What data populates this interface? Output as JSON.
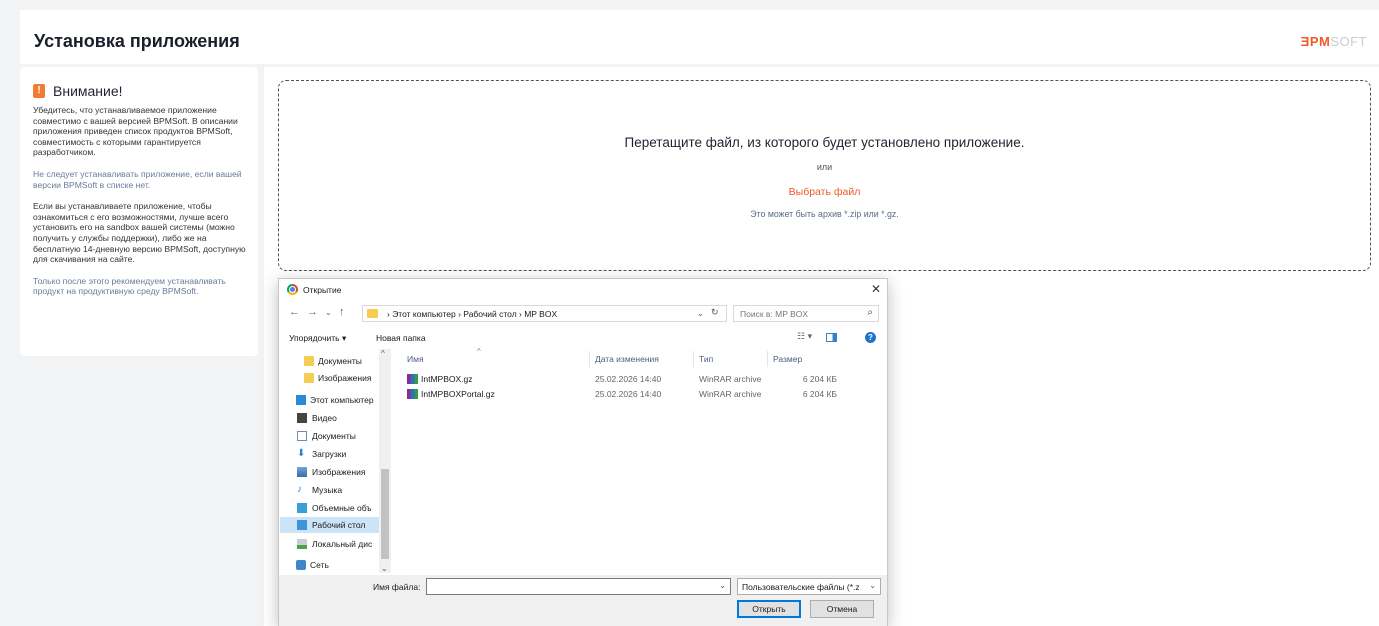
{
  "header": {
    "title": "Установка приложения",
    "logo_a": "ƎPM",
    "logo_b": "SOFT"
  },
  "warning": {
    "title": "Внимание!",
    "p1": "Убедитесь, что устанавливаемое приложение совместимо с вашей версией BPMSoft. В описании приложения приведен список продуктов BPMSoft, совместимость с которыми гарантируется разработчиком.",
    "p2": "Не следует устанавливать приложение, если вашей версии BPMSoft в списке нет.",
    "p3": "Если вы устанавливаете приложение, чтобы ознакомиться с его возможностями, лучше всего установить его на sandbox вашей системы (можно получить у службы поддержки), либо же на бесплатную 14-дневную версию BPMSoft, доступную для скачивания на сайте.",
    "p4": "Только после этого рекомендуем устанавливать продукт на продуктивную среду BPMSoft."
  },
  "dropzone": {
    "main": "Перетащите файл, из которого будет установлено приложение.",
    "or": "или",
    "pick": "Выбрать файл",
    "hint": "Это может быть архив *.zip или *.gz."
  },
  "dialog": {
    "title": "Открытие",
    "path": "›  Этот компьютер  ›  Рабочий стол  ›  MP BOX",
    "search_placeholder": "Поиск в: MP BOX",
    "organize": "Упорядочить ▾",
    "new_folder": "Новая папка",
    "nav": [
      "Документы",
      "Изображения",
      "Этот компьютер",
      "Видео",
      "Документы",
      "Загрузки",
      "Изображения",
      "Музыка",
      "Объемные объ",
      "Рабочий стол",
      "Локальный дис",
      "Сеть"
    ],
    "columns": {
      "name": "Имя",
      "date": "Дата изменения",
      "type": "Тип",
      "size": "Размер"
    },
    "files": [
      {
        "name": "IntMPBOX.gz",
        "date": "25.02.2026 14:40",
        "type": "WinRAR archive",
        "size": "6 204 КБ"
      },
      {
        "name": "IntMPBOXPortal.gz",
        "date": "25.02.2026 14:40",
        "type": "WinRAR archive",
        "size": "6 204 КБ"
      }
    ],
    "filename_label": "Имя файла:",
    "filename_value": "",
    "filetype": "Пользовательские файлы (*.z",
    "open": "Открыть",
    "cancel": "Отмена"
  }
}
